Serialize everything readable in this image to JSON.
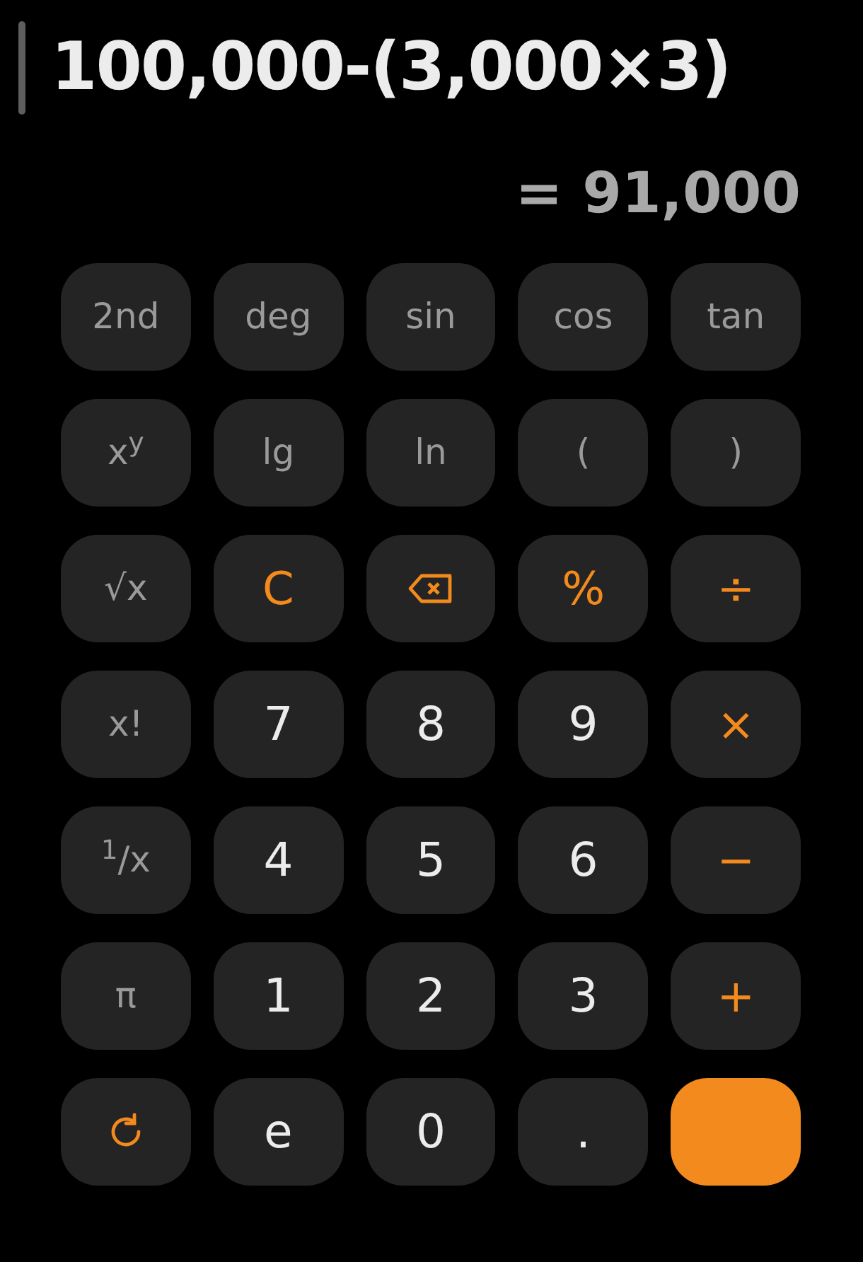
{
  "display": {
    "expression": "100,000-(3,000×3)",
    "result": "= 91,000"
  },
  "keys": [
    {
      "kind": "function",
      "label": "2nd"
    },
    {
      "kind": "function",
      "label": "deg"
    },
    {
      "kind": "function",
      "label": "sin"
    },
    {
      "kind": "function",
      "label": "cos"
    },
    {
      "kind": "function",
      "label": "tan"
    },
    {
      "kind": "function",
      "label": "x$^{y}$"
    },
    {
      "kind": "function",
      "label": "lg"
    },
    {
      "kind": "function",
      "label": "ln"
    },
    {
      "kind": "function",
      "label": "("
    },
    {
      "kind": "function",
      "label": ")"
    },
    {
      "kind": "function",
      "label": "√x"
    },
    {
      "kind": "operator",
      "label": "C"
    },
    {
      "kind": "backspace"
    },
    {
      "kind": "operator",
      "label": "%"
    },
    {
      "kind": "operator",
      "label": "÷"
    },
    {
      "kind": "function",
      "label": "x!"
    },
    {
      "kind": "digit",
      "label": "7"
    },
    {
      "kind": "digit",
      "label": "8"
    },
    {
      "kind": "digit",
      "label": "9"
    },
    {
      "kind": "operator",
      "label": "×"
    },
    {
      "kind": "function",
      "label": "$^{1}$/x"
    },
    {
      "kind": "digit",
      "label": "4"
    },
    {
      "kind": "digit",
      "label": "5"
    },
    {
      "kind": "digit",
      "label": "6"
    },
    {
      "kind": "operator",
      "label": "−"
    },
    {
      "kind": "function",
      "label": "π"
    },
    {
      "kind": "digit",
      "label": "1"
    },
    {
      "kind": "digit",
      "label": "2"
    },
    {
      "kind": "digit",
      "label": "3"
    },
    {
      "kind": "operator",
      "label": "+"
    },
    {
      "kind": "toggle"
    },
    {
      "kind": "digit",
      "label": "e"
    },
    {
      "kind": "digit",
      "label": "0"
    },
    {
      "kind": "digit",
      "label": "."
    },
    {
      "kind": "equals"
    }
  ]
}
